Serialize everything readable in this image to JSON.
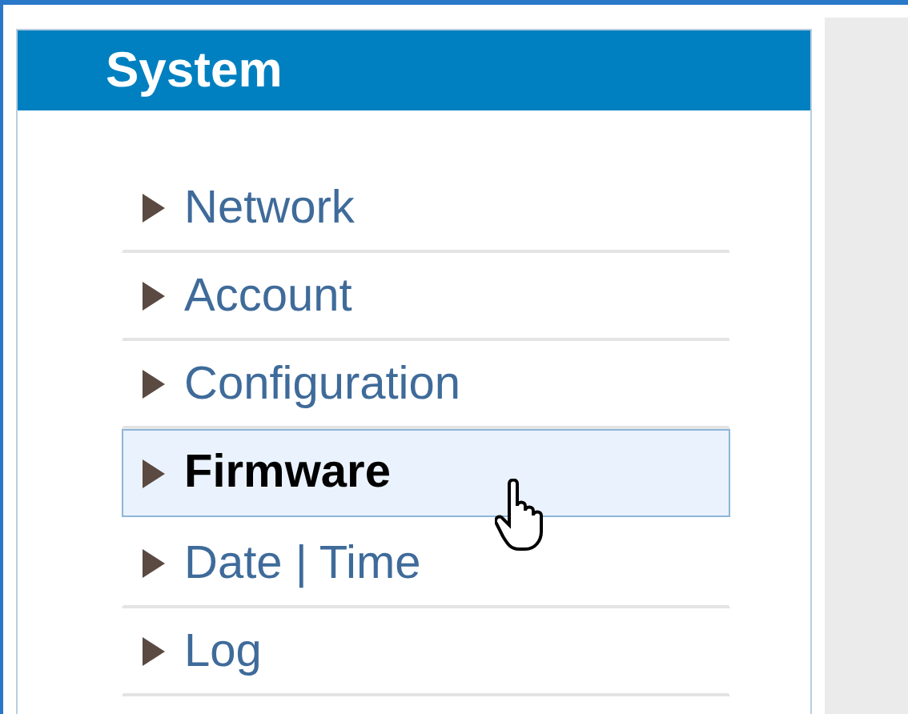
{
  "panel": {
    "title": "System"
  },
  "menu": [
    {
      "label": "Network",
      "selected": false
    },
    {
      "label": "Account",
      "selected": false
    },
    {
      "label": "Configuration",
      "selected": false
    },
    {
      "label": "Firmware",
      "selected": true
    },
    {
      "label": "Date | Time",
      "selected": false
    },
    {
      "label": "Log",
      "selected": false
    }
  ]
}
